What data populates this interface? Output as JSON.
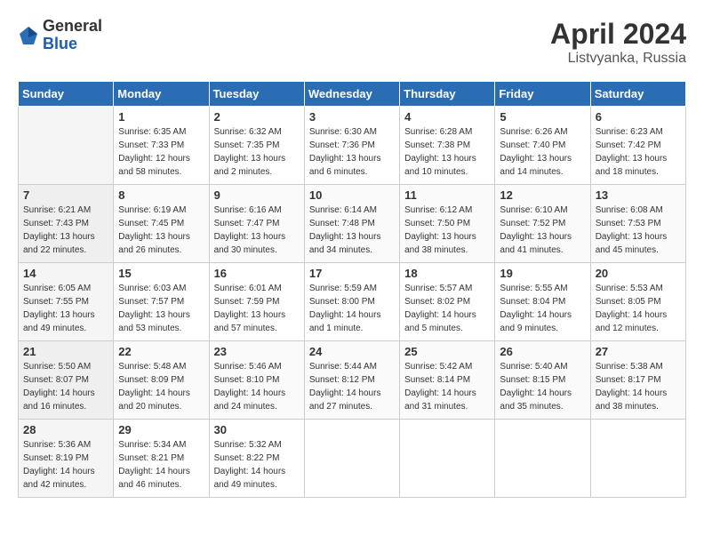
{
  "logo": {
    "general": "General",
    "blue": "Blue"
  },
  "title": "April 2024",
  "subtitle": "Listvyanka, Russia",
  "days_of_week": [
    "Sunday",
    "Monday",
    "Tuesday",
    "Wednesday",
    "Thursday",
    "Friday",
    "Saturday"
  ],
  "weeks": [
    [
      {
        "day": "",
        "info": ""
      },
      {
        "day": "1",
        "info": "Sunrise: 6:35 AM\nSunset: 7:33 PM\nDaylight: 12 hours\nand 58 minutes."
      },
      {
        "day": "2",
        "info": "Sunrise: 6:32 AM\nSunset: 7:35 PM\nDaylight: 13 hours\nand 2 minutes."
      },
      {
        "day": "3",
        "info": "Sunrise: 6:30 AM\nSunset: 7:36 PM\nDaylight: 13 hours\nand 6 minutes."
      },
      {
        "day": "4",
        "info": "Sunrise: 6:28 AM\nSunset: 7:38 PM\nDaylight: 13 hours\nand 10 minutes."
      },
      {
        "day": "5",
        "info": "Sunrise: 6:26 AM\nSunset: 7:40 PM\nDaylight: 13 hours\nand 14 minutes."
      },
      {
        "day": "6",
        "info": "Sunrise: 6:23 AM\nSunset: 7:42 PM\nDaylight: 13 hours\nand 18 minutes."
      }
    ],
    [
      {
        "day": "7",
        "info": "Sunrise: 6:21 AM\nSunset: 7:43 PM\nDaylight: 13 hours\nand 22 minutes."
      },
      {
        "day": "8",
        "info": "Sunrise: 6:19 AM\nSunset: 7:45 PM\nDaylight: 13 hours\nand 26 minutes."
      },
      {
        "day": "9",
        "info": "Sunrise: 6:16 AM\nSunset: 7:47 PM\nDaylight: 13 hours\nand 30 minutes."
      },
      {
        "day": "10",
        "info": "Sunrise: 6:14 AM\nSunset: 7:48 PM\nDaylight: 13 hours\nand 34 minutes."
      },
      {
        "day": "11",
        "info": "Sunrise: 6:12 AM\nSunset: 7:50 PM\nDaylight: 13 hours\nand 38 minutes."
      },
      {
        "day": "12",
        "info": "Sunrise: 6:10 AM\nSunset: 7:52 PM\nDaylight: 13 hours\nand 41 minutes."
      },
      {
        "day": "13",
        "info": "Sunrise: 6:08 AM\nSunset: 7:53 PM\nDaylight: 13 hours\nand 45 minutes."
      }
    ],
    [
      {
        "day": "14",
        "info": "Sunrise: 6:05 AM\nSunset: 7:55 PM\nDaylight: 13 hours\nand 49 minutes."
      },
      {
        "day": "15",
        "info": "Sunrise: 6:03 AM\nSunset: 7:57 PM\nDaylight: 13 hours\nand 53 minutes."
      },
      {
        "day": "16",
        "info": "Sunrise: 6:01 AM\nSunset: 7:59 PM\nDaylight: 13 hours\nand 57 minutes."
      },
      {
        "day": "17",
        "info": "Sunrise: 5:59 AM\nSunset: 8:00 PM\nDaylight: 14 hours\nand 1 minute."
      },
      {
        "day": "18",
        "info": "Sunrise: 5:57 AM\nSunset: 8:02 PM\nDaylight: 14 hours\nand 5 minutes."
      },
      {
        "day": "19",
        "info": "Sunrise: 5:55 AM\nSunset: 8:04 PM\nDaylight: 14 hours\nand 9 minutes."
      },
      {
        "day": "20",
        "info": "Sunrise: 5:53 AM\nSunset: 8:05 PM\nDaylight: 14 hours\nand 12 minutes."
      }
    ],
    [
      {
        "day": "21",
        "info": "Sunrise: 5:50 AM\nSunset: 8:07 PM\nDaylight: 14 hours\nand 16 minutes."
      },
      {
        "day": "22",
        "info": "Sunrise: 5:48 AM\nSunset: 8:09 PM\nDaylight: 14 hours\nand 20 minutes."
      },
      {
        "day": "23",
        "info": "Sunrise: 5:46 AM\nSunset: 8:10 PM\nDaylight: 14 hours\nand 24 minutes."
      },
      {
        "day": "24",
        "info": "Sunrise: 5:44 AM\nSunset: 8:12 PM\nDaylight: 14 hours\nand 27 minutes."
      },
      {
        "day": "25",
        "info": "Sunrise: 5:42 AM\nSunset: 8:14 PM\nDaylight: 14 hours\nand 31 minutes."
      },
      {
        "day": "26",
        "info": "Sunrise: 5:40 AM\nSunset: 8:15 PM\nDaylight: 14 hours\nand 35 minutes."
      },
      {
        "day": "27",
        "info": "Sunrise: 5:38 AM\nSunset: 8:17 PM\nDaylight: 14 hours\nand 38 minutes."
      }
    ],
    [
      {
        "day": "28",
        "info": "Sunrise: 5:36 AM\nSunset: 8:19 PM\nDaylight: 14 hours\nand 42 minutes."
      },
      {
        "day": "29",
        "info": "Sunrise: 5:34 AM\nSunset: 8:21 PM\nDaylight: 14 hours\nand 46 minutes."
      },
      {
        "day": "30",
        "info": "Sunrise: 5:32 AM\nSunset: 8:22 PM\nDaylight: 14 hours\nand 49 minutes."
      },
      {
        "day": "",
        "info": ""
      },
      {
        "day": "",
        "info": ""
      },
      {
        "day": "",
        "info": ""
      },
      {
        "day": "",
        "info": ""
      }
    ]
  ]
}
